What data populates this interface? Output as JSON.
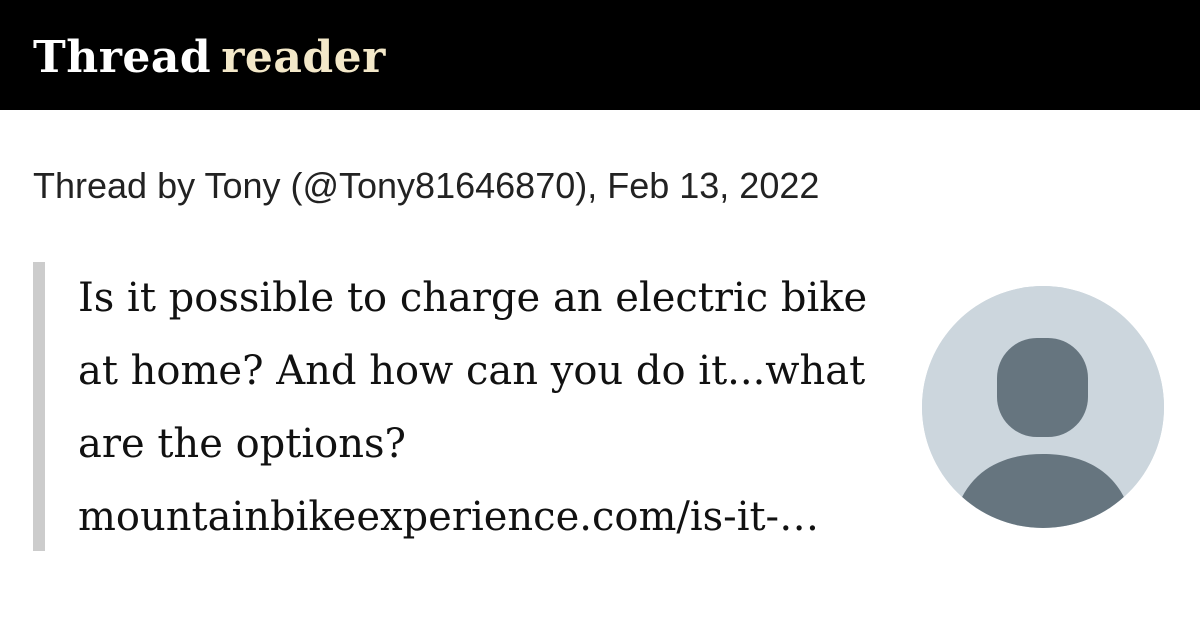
{
  "header": {
    "brand_word1": "Thread",
    "brand_word2": "reader"
  },
  "thread": {
    "byline": "Thread by Tony (@Tony81646870), Feb 13, 2022",
    "text_lines": [
      "Is it possible to charge an electric bike",
      "at home? And how can you do it...what",
      "are the options?",
      "mountainbikeexperience.com/is-it-…"
    ]
  },
  "avatar": {
    "icon": "default-profile-icon",
    "background_color": "#ccd6dd",
    "figure_color": "#66757f"
  },
  "colors": {
    "topbar": "#000000",
    "brand_word2": "#f3e8c9",
    "quote_bar": "#cccccc"
  }
}
